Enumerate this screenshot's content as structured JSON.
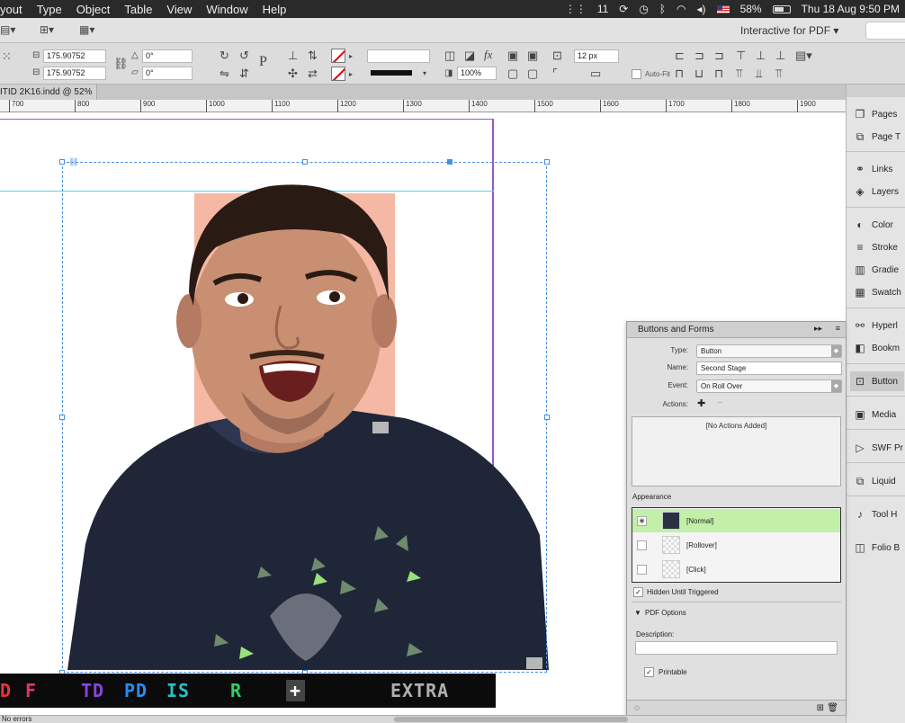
{
  "menubar": {
    "menus": [
      "yout",
      "Type",
      "Object",
      "Table",
      "View",
      "Window",
      "Help"
    ],
    "status_number": "11",
    "battery": "58%",
    "datetime": "Thu 18 Aug  9:50 PM"
  },
  "appbar": {
    "workspace": "Interactive for PDF"
  },
  "control": {
    "w_value": "175.90752",
    "h_value": "175.90752",
    "rotate_value": "0°",
    "shear_value": "0°",
    "opacity_value": "100%",
    "spacing_value": "12 px",
    "autofit_label": "Auto-Fit"
  },
  "document": {
    "tab_title": "ITID 2K16.indd @ 52%"
  },
  "ruler": {
    "labels": [
      "700",
      "800",
      "900",
      "1000",
      "1100",
      "1200",
      "1300",
      "1400",
      "1500",
      "1600",
      "1700",
      "1800",
      "1900"
    ]
  },
  "strip": {
    "buttons": [
      {
        "label": "D",
        "color": "#e8333c"
      },
      {
        "label": "F",
        "color": "#e83369"
      },
      {
        "label": "TD",
        "color": "#8b44e0"
      },
      {
        "label": "PD",
        "color": "#2a8cf0"
      },
      {
        "label": "IS",
        "color": "#27c0c8"
      },
      {
        "label": "R",
        "color": "#33cc66"
      },
      {
        "label": "+",
        "color": "#ffffff"
      },
      {
        "label": "EXTRA",
        "color": "#b0b0b0"
      }
    ]
  },
  "dock": {
    "items": [
      "Pages",
      "Page T",
      "Links",
      "Layers",
      "Color",
      "Stroke",
      "Gradie",
      "Swatch",
      "Hyperl",
      "Bookm",
      "Button",
      "Media",
      "SWF Pr",
      "Liquid",
      "Tool H",
      "Folio B"
    ]
  },
  "panel": {
    "title": "Buttons and Forms",
    "type_label": "Type:",
    "type_value": "Button",
    "name_label": "Name:",
    "name_value": "Second Stage",
    "event_label": "Event:",
    "event_value": "On Roll Over",
    "actions_label": "Actions:",
    "no_actions": "[No Actions Added]",
    "appearance_label": "Appearance",
    "states": [
      "[Normal]",
      "[Rollover]",
      "[Click]"
    ],
    "hidden_label": "Hidden Until Triggered",
    "pdf_options_label": "PDF Options",
    "description_label": "Description:",
    "printable_label": "Printable"
  },
  "statusbar": {
    "errors": "No errors"
  },
  "colors": {
    "frame_selection": "#4a90e2",
    "page_edge": "#9b59c4",
    "guide": "#5fd0e8",
    "selected_state": "#c2f0a8"
  }
}
